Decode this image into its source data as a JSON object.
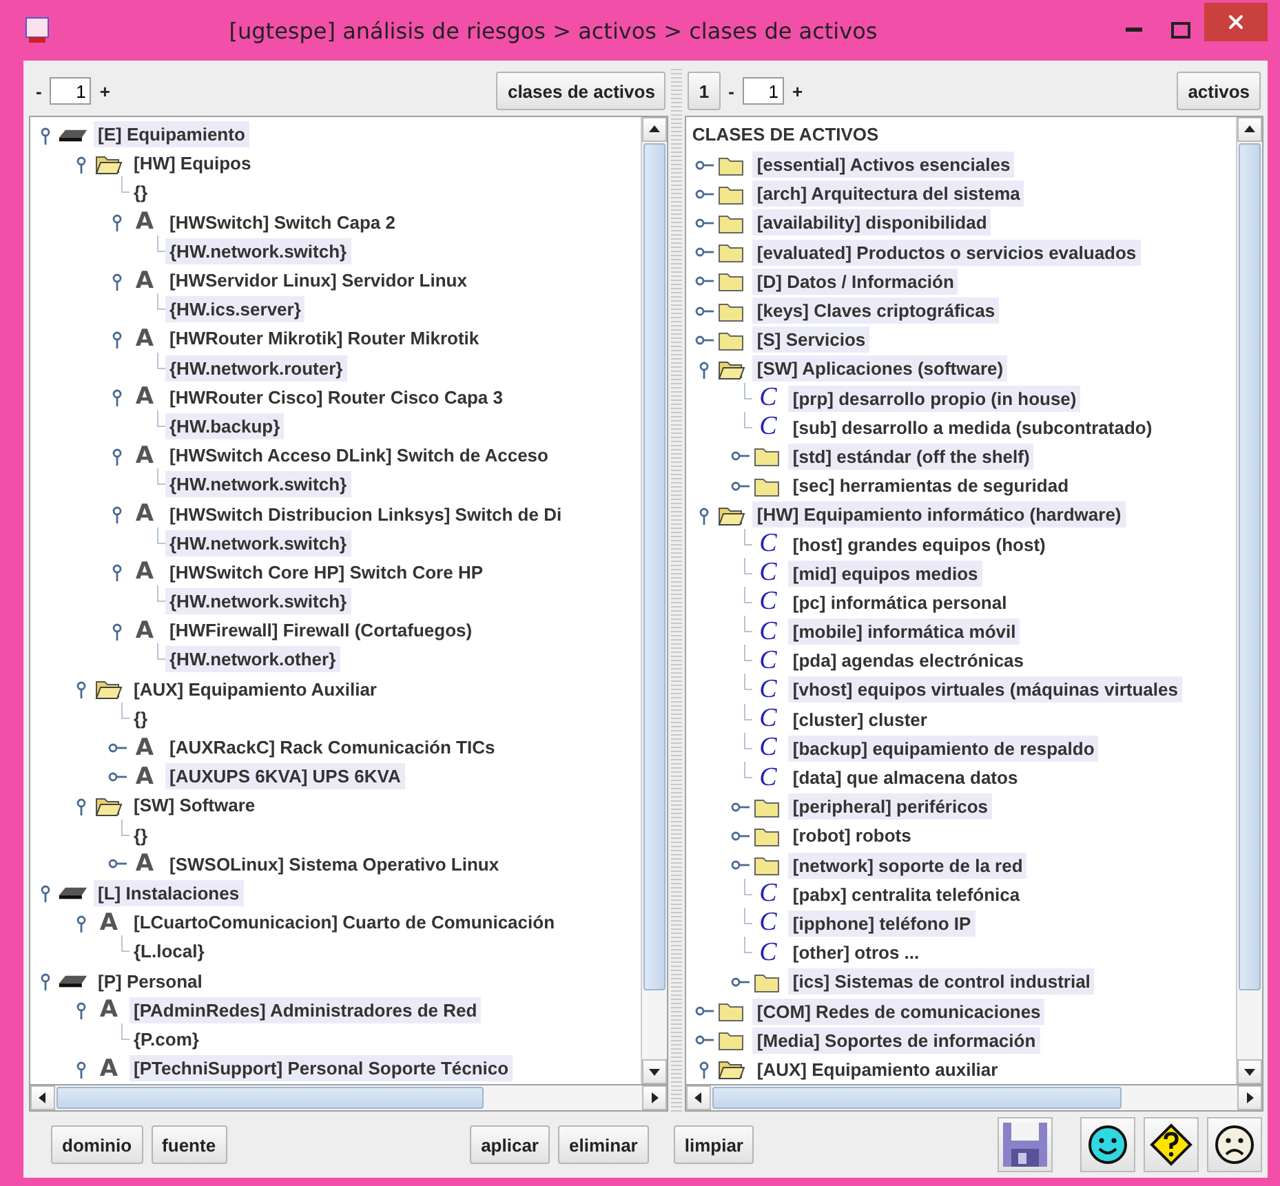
{
  "window": {
    "title": "[ugtespe] análisis de riesgos > activos > clases de activos"
  },
  "left_panel": {
    "toolbar": {
      "minus": "-",
      "page": "1",
      "plus": "+",
      "button": "clases de activos"
    },
    "tree": [
      {
        "label": "[E] Equipamiento",
        "kind": "drawer",
        "expanded": true,
        "highlighted": true,
        "children": [
          {
            "label": "[HW] Equipos",
            "kind": "folder",
            "expanded": true,
            "highlighted": false,
            "children": [
              {
                "label": "{}",
                "kind": "value",
                "highlighted": false
              },
              {
                "label": "[HWSwitch] Switch Capa 2",
                "kind": "attribute",
                "glyph": "A",
                "expanded": true,
                "highlighted": false,
                "children": [
                  {
                    "label": "{HW.network.switch}",
                    "kind": "value",
                    "highlighted": true
                  }
                ]
              },
              {
                "label": "[HWServidor Linux] Servidor Linux",
                "kind": "attribute",
                "glyph": "A",
                "expanded": true,
                "highlighted": false,
                "children": [
                  {
                    "label": "{HW.ics.server}",
                    "kind": "value",
                    "highlighted": true
                  }
                ]
              },
              {
                "label": "[HWRouter Mikrotik] Router Mikrotik",
                "kind": "attribute",
                "glyph": "A",
                "expanded": true,
                "highlighted": false,
                "children": [
                  {
                    "label": "{HW.network.router}",
                    "kind": "value",
                    "highlighted": true
                  }
                ]
              },
              {
                "label": "[HWRouter Cisco] Router Cisco Capa 3",
                "kind": "attribute",
                "glyph": "A",
                "expanded": true,
                "highlighted": false,
                "children": [
                  {
                    "label": "{HW.backup}",
                    "kind": "value",
                    "highlighted": true
                  }
                ]
              },
              {
                "label": "[HWSwitch Acceso DLink] Switch de Acceso",
                "kind": "attribute",
                "glyph": "A",
                "expanded": true,
                "highlighted": false,
                "children": [
                  {
                    "label": "{HW.network.switch}",
                    "kind": "value",
                    "highlighted": true
                  }
                ]
              },
              {
                "label": "[HWSwitch Distribucion Linksys] Switch de Di",
                "kind": "attribute",
                "glyph": "A",
                "expanded": true,
                "highlighted": false,
                "children": [
                  {
                    "label": "{HW.network.switch}",
                    "kind": "value",
                    "highlighted": true
                  }
                ]
              },
              {
                "label": "[HWSwitch Core HP] Switch Core HP",
                "kind": "attribute",
                "glyph": "A",
                "expanded": true,
                "highlighted": false,
                "children": [
                  {
                    "label": "{HW.network.switch}",
                    "kind": "value",
                    "highlighted": true
                  }
                ]
              },
              {
                "label": "[HWFirewall] Firewall (Cortafuegos)",
                "kind": "attribute",
                "glyph": "A",
                "expanded": true,
                "highlighted": false,
                "children": [
                  {
                    "label": "{HW.network.other}",
                    "kind": "value",
                    "highlighted": true
                  }
                ]
              }
            ]
          },
          {
            "label": "[AUX] Equipamiento Auxiliar",
            "kind": "folder",
            "expanded": true,
            "highlighted": false,
            "children": [
              {
                "label": "{}",
                "kind": "value",
                "highlighted": false
              },
              {
                "label": "[AUXRackC] Rack Comunicación TICs",
                "kind": "attribute",
                "glyph": "A",
                "expanded": false,
                "highlighted": false
              },
              {
                "label": "[AUXUPS 6KVA] UPS 6KVA",
                "kind": "attribute",
                "glyph": "A",
                "expanded": false,
                "highlighted": true
              }
            ]
          },
          {
            "label": "[SW] Software",
            "kind": "folder",
            "expanded": true,
            "highlighted": false,
            "children": [
              {
                "label": "{}",
                "kind": "value",
                "highlighted": false
              },
              {
                "label": "[SWSOLinux] Sistema Operativo Linux",
                "kind": "attribute",
                "glyph": "A",
                "expanded": false,
                "highlighted": false
              }
            ]
          }
        ]
      },
      {
        "label": "[L] Instalaciones",
        "kind": "drawer",
        "expanded": true,
        "highlighted": true,
        "children": [
          {
            "label": "[LCuartoComunicacion] Cuarto de Comunicación",
            "kind": "attribute",
            "glyph": "A",
            "expanded": true,
            "highlighted": false,
            "children": [
              {
                "label": "{L.local}",
                "kind": "value",
                "highlighted": false
              }
            ]
          }
        ]
      },
      {
        "label": "[P] Personal",
        "kind": "drawer",
        "expanded": true,
        "highlighted": false,
        "children": [
          {
            "label": "[PAdminRedes] Administradores de Red",
            "kind": "attribute",
            "glyph": "A",
            "expanded": true,
            "highlighted": true,
            "children": [
              {
                "label": "{P.com}",
                "kind": "value",
                "highlighted": false
              }
            ]
          },
          {
            "label": "[PTechniSupport] Personal Soporte Técnico",
            "kind": "attribute",
            "glyph": "A",
            "expanded": true,
            "highlighted": true
          }
        ]
      }
    ]
  },
  "right_panel": {
    "toolbar": {
      "level": "1",
      "minus": "-",
      "page": "1",
      "plus": "+",
      "button": "activos"
    },
    "tree_header": "CLASES DE ACTIVOS",
    "tree": [
      {
        "label": "[essential] Activos esenciales",
        "kind": "folder",
        "expanded": false,
        "highlighted": true
      },
      {
        "label": "[arch] Arquitectura del sistema",
        "kind": "folder",
        "expanded": false,
        "highlighted": true
      },
      {
        "label": "[availability] disponibilidad",
        "kind": "folder",
        "expanded": false,
        "highlighted": true
      },
      {
        "label": "[evaluated] Productos o servicios evaluados",
        "kind": "folder",
        "expanded": false,
        "highlighted": true
      },
      {
        "label": "[D] Datos / Información",
        "kind": "folder",
        "expanded": false,
        "highlighted": true
      },
      {
        "label": "[keys] Claves criptográficas",
        "kind": "folder",
        "expanded": false,
        "highlighted": true
      },
      {
        "label": "[S] Servicios",
        "kind": "folder",
        "expanded": false,
        "highlighted": true
      },
      {
        "label": "[SW] Aplicaciones (software)",
        "kind": "folder",
        "expanded": true,
        "highlighted": true,
        "children": [
          {
            "label": "[prp] desarrollo propio (in house)",
            "kind": "class",
            "glyph": "C",
            "highlighted": true
          },
          {
            "label": "[sub] desarrollo a medida (subcontratado)",
            "kind": "class",
            "glyph": "C",
            "highlighted": false
          },
          {
            "label": "[std] estándar (off the shelf)",
            "kind": "folder",
            "expanded": false,
            "highlighted": true
          },
          {
            "label": "[sec] herramientas de seguridad",
            "kind": "folder",
            "expanded": false,
            "highlighted": false
          }
        ]
      },
      {
        "label": "[HW] Equipamiento informático (hardware)",
        "kind": "folder",
        "expanded": true,
        "highlighted": true,
        "children": [
          {
            "label": "[host] grandes equipos (host)",
            "kind": "class",
            "glyph": "C",
            "highlighted": false
          },
          {
            "label": "[mid] equipos medios",
            "kind": "class",
            "glyph": "C",
            "highlighted": true
          },
          {
            "label": "[pc] informática personal",
            "kind": "class",
            "glyph": "C",
            "highlighted": false
          },
          {
            "label": "[mobile] informática móvil",
            "kind": "class",
            "glyph": "C",
            "highlighted": true
          },
          {
            "label": "[pda] agendas electrónicas",
            "kind": "class",
            "glyph": "C",
            "highlighted": false
          },
          {
            "label": "[vhost] equipos virtuales (máquinas virtuales",
            "kind": "class",
            "glyph": "C",
            "highlighted": true
          },
          {
            "label": "[cluster] cluster",
            "kind": "class",
            "glyph": "C",
            "highlighted": false
          },
          {
            "label": "[backup] equipamiento de respaldo",
            "kind": "class",
            "glyph": "C",
            "highlighted": true
          },
          {
            "label": "[data] que almacena datos",
            "kind": "class",
            "glyph": "C",
            "highlighted": false
          },
          {
            "label": "[peripheral] periféricos",
            "kind": "folder",
            "expanded": false,
            "highlighted": true
          },
          {
            "label": "[robot] robots",
            "kind": "folder",
            "expanded": false,
            "highlighted": false
          },
          {
            "label": "[network] soporte de la red",
            "kind": "folder",
            "expanded": false,
            "highlighted": true
          },
          {
            "label": "[pabx] centralita telefónica",
            "kind": "class",
            "glyph": "C",
            "highlighted": false
          },
          {
            "label": "[ipphone] teléfono IP",
            "kind": "class",
            "glyph": "C",
            "highlighted": true
          },
          {
            "label": "[other] otros ...",
            "kind": "class",
            "glyph": "C",
            "highlighted": false
          },
          {
            "label": "[ics] Sistemas de control industrial",
            "kind": "folder",
            "expanded": false,
            "highlighted": true
          }
        ]
      },
      {
        "label": "[COM] Redes de comunicaciones",
        "kind": "folder",
        "expanded": false,
        "highlighted": true
      },
      {
        "label": "[Media] Soportes de información",
        "kind": "folder",
        "expanded": false,
        "highlighted": true
      },
      {
        "label": "[AUX] Equipamiento auxiliar",
        "kind": "folder",
        "expanded": true,
        "highlighted": false
      }
    ]
  },
  "left_buttons": [
    "dominio",
    "fuente"
  ],
  "action_buttons": [
    "aplicar",
    "eliminar",
    "limpiar"
  ]
}
